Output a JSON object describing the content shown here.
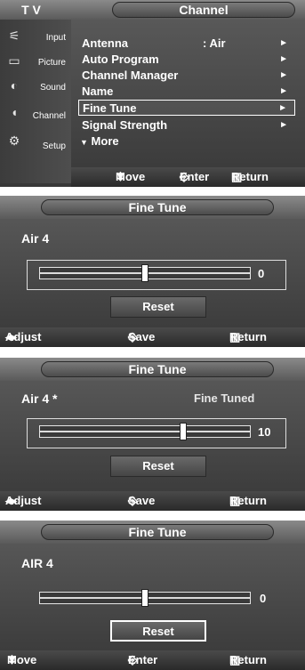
{
  "panel1": {
    "tab": "T V",
    "title": "Channel",
    "sidebar": [
      {
        "label": "Input",
        "icon": "input-icon"
      },
      {
        "label": "Picture",
        "icon": "picture-icon"
      },
      {
        "label": "Sound",
        "icon": "sound-icon"
      },
      {
        "label": "Channel",
        "icon": "channel-icon"
      },
      {
        "label": "Setup",
        "icon": "setup-icon"
      }
    ],
    "menu": [
      {
        "label": "Antenna",
        "value": ": Air",
        "arrow": "►"
      },
      {
        "label": "Auto Program",
        "value": "",
        "arrow": "►"
      },
      {
        "label": "Channel Manager",
        "value": "",
        "arrow": "►"
      },
      {
        "label": "Name",
        "value": "",
        "arrow": "►"
      },
      {
        "label": "Fine Tune",
        "value": "",
        "arrow": "►"
      },
      {
        "label": "Signal Strength",
        "value": "",
        "arrow": "►"
      },
      {
        "label": "More",
        "value": "",
        "arrow": ""
      }
    ],
    "footer": {
      "move": "Move",
      "enter": "Enter",
      "return": "Return"
    }
  },
  "panel2": {
    "title": "Fine Tune",
    "channel": "Air  4",
    "status": "",
    "value": "0",
    "slider_fraction": 0.5,
    "reset": "Reset",
    "footer": {
      "adjust": "Adjust",
      "save": "Save",
      "return": "Return"
    }
  },
  "panel3": {
    "title": "Fine Tune",
    "channel": "Air  4 *",
    "status": "Fine Tuned",
    "value": "10",
    "slider_fraction": 0.69,
    "reset": "Reset",
    "footer": {
      "adjust": "Adjust",
      "save": "Save",
      "return": "Return"
    }
  },
  "panel4": {
    "title": "Fine Tune",
    "channel": "AIR  4",
    "value": "0",
    "slider_fraction": 0.5,
    "reset": "Reset",
    "footer": {
      "move": "Move",
      "enter": "Enter",
      "return": "Return"
    }
  },
  "colors": {
    "panel_bg": "#4a4a4a",
    "text": "#ffffff"
  }
}
